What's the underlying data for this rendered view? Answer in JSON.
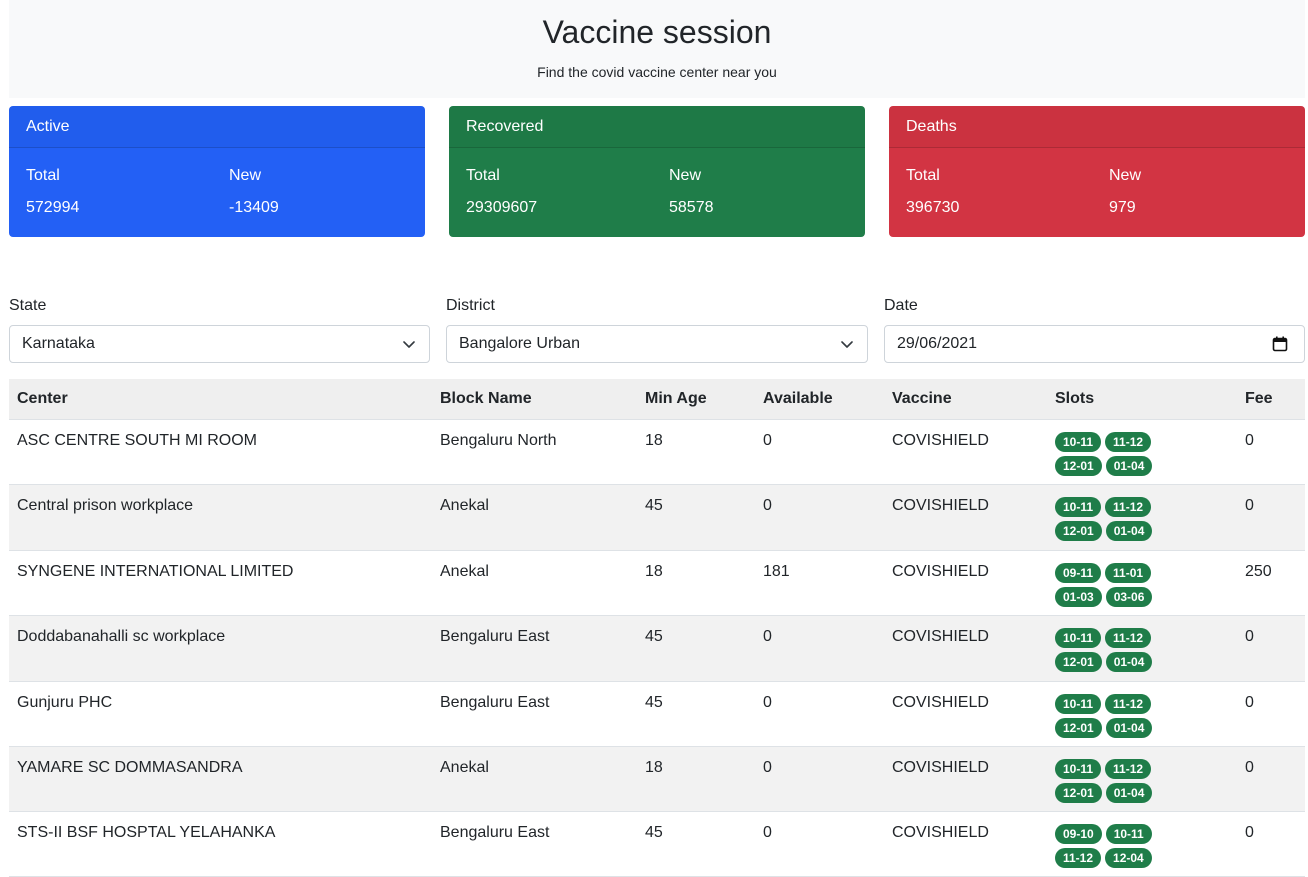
{
  "header": {
    "title": "Vaccine session",
    "subtitle": "Find the covid vaccine center near you"
  },
  "stats": {
    "active": {
      "title": "Active",
      "total_label": "Total",
      "new_label": "New",
      "total": "572994",
      "new": "-13409",
      "color": "#2360f5"
    },
    "recovered": {
      "title": "Recovered",
      "total_label": "Total",
      "new_label": "New",
      "total": "29309607",
      "new": "58578",
      "color": "#1f7d49"
    },
    "deaths": {
      "title": "Deaths",
      "total_label": "Total",
      "new_label": "New",
      "total": "396730",
      "new": "979",
      "color": "#d23443"
    }
  },
  "filters": {
    "state_label": "State",
    "state_value": "Karnataka",
    "district_label": "District",
    "district_value": "Bangalore Urban",
    "date_label": "Date",
    "date_value": "29/06/2021"
  },
  "table": {
    "headers": [
      "Center",
      "Block Name",
      "Min Age",
      "Available",
      "Vaccine",
      "Slots",
      "Fee"
    ],
    "rows": [
      {
        "center": "ASC CENTRE SOUTH MI ROOM",
        "block": "Bengaluru North",
        "min_age": "18",
        "available": "0",
        "vaccine": "COVISHIELD",
        "slots": [
          "10-11",
          "11-12",
          "12-01",
          "01-04"
        ],
        "fee": "0"
      },
      {
        "center": "Central prison workplace",
        "block": "Anekal",
        "min_age": "45",
        "available": "0",
        "vaccine": "COVISHIELD",
        "slots": [
          "10-11",
          "11-12",
          "12-01",
          "01-04"
        ],
        "fee": "0"
      },
      {
        "center": "SYNGENE INTERNATIONAL LIMITED",
        "block": "Anekal",
        "min_age": "18",
        "available": "181",
        "vaccine": "COVISHIELD",
        "slots": [
          "09-11",
          "11-01",
          "01-03",
          "03-06"
        ],
        "fee": "250"
      },
      {
        "center": "Doddabanahalli sc workplace",
        "block": "Bengaluru East",
        "min_age": "45",
        "available": "0",
        "vaccine": "COVISHIELD",
        "slots": [
          "10-11",
          "11-12",
          "12-01",
          "01-04"
        ],
        "fee": "0"
      },
      {
        "center": "Gunjuru PHC",
        "block": "Bengaluru East",
        "min_age": "45",
        "available": "0",
        "vaccine": "COVISHIELD",
        "slots": [
          "10-11",
          "11-12",
          "12-01",
          "01-04"
        ],
        "fee": "0"
      },
      {
        "center": "YAMARE SC DOMMASANDRA",
        "block": "Anekal",
        "min_age": "18",
        "available": "0",
        "vaccine": "COVISHIELD",
        "slots": [
          "10-11",
          "11-12",
          "12-01",
          "01-04"
        ],
        "fee": "0"
      },
      {
        "center": "STS-II BSF HOSPTAL YELAHANKA",
        "block": "Bengaluru East",
        "min_age": "45",
        "available": "0",
        "vaccine": "COVISHIELD",
        "slots": [
          "09-10",
          "10-11",
          "11-12",
          "12-04"
        ],
        "fee": "0"
      }
    ]
  },
  "icons": {
    "state_select": "chevron-down-icon",
    "district_select": "chevron-down-icon",
    "date_picker": "calendar-icon"
  }
}
